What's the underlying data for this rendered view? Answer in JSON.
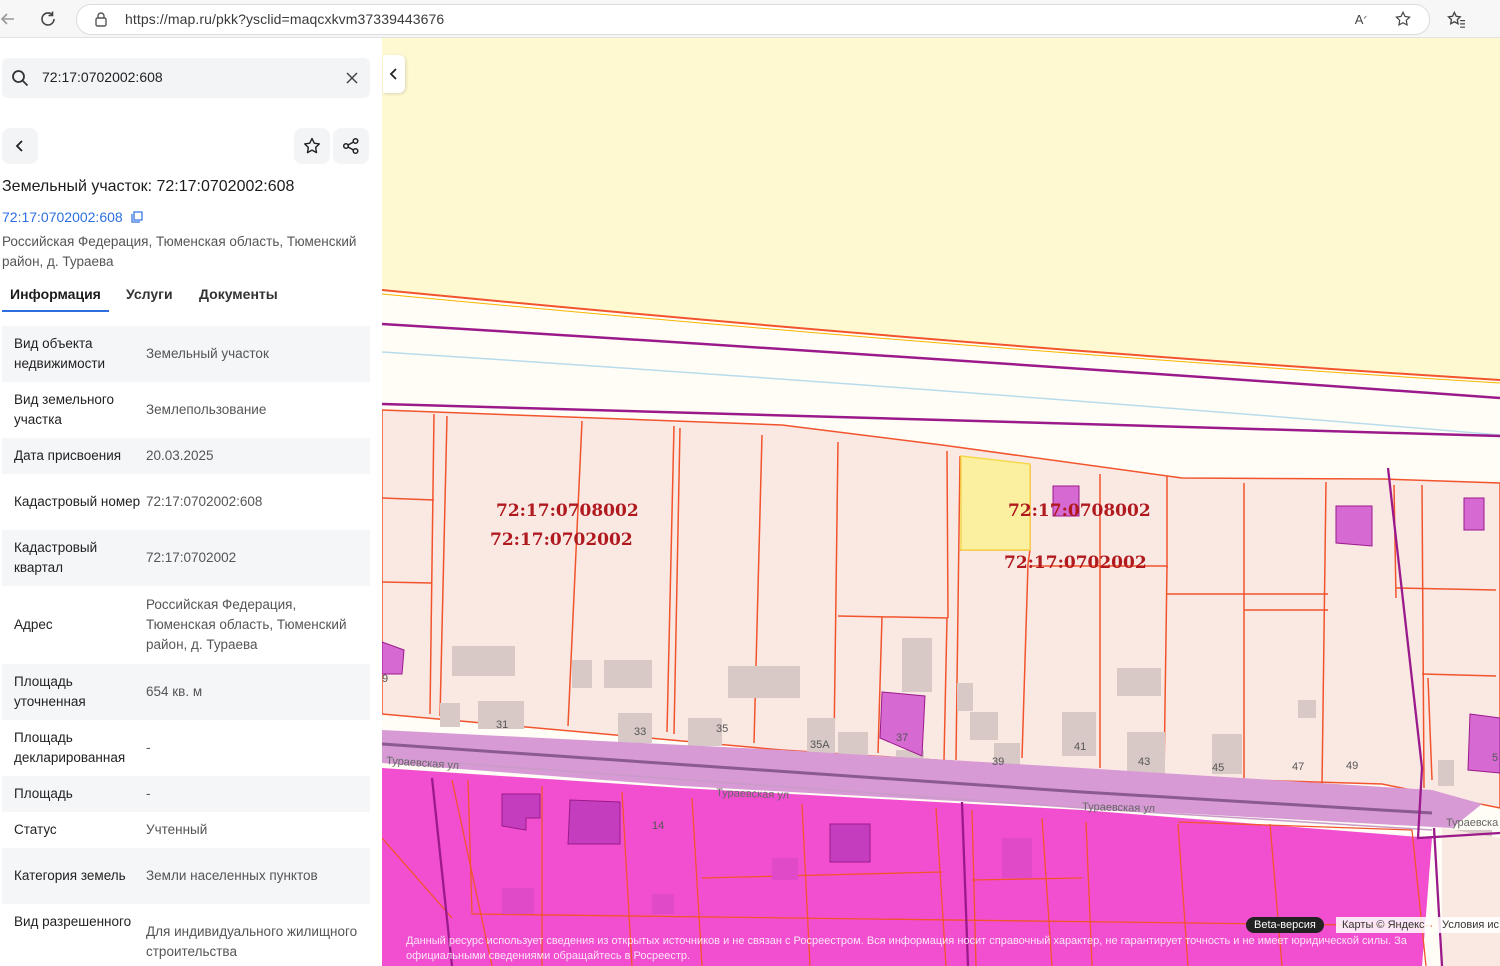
{
  "browser": {
    "url": "https://map.ru/pkk?ysclid=maqcxkvm37339443676",
    "icons": [
      "back-arrow-icon",
      "refresh-icon",
      "site-info-icon",
      "read-aloud-icon",
      "favorite-star-icon",
      "favorites-bar-icon"
    ]
  },
  "search": {
    "value": "72:17:0702002:608",
    "icons": [
      "search-icon",
      "clear-icon"
    ]
  },
  "card": {
    "title": "Земельный участок: 72:17:0702002:608",
    "cadastral_link": "72:17:0702002:608",
    "address": "Российская Федерация, Тюменская область, Тюменский район, д. Тураева"
  },
  "tabs": [
    {
      "label": "Информация",
      "active": true
    },
    {
      "label": "Услуги",
      "active": false
    },
    {
      "label": "Документы",
      "active": false
    }
  ],
  "properties": [
    {
      "key": "Вид объекта недвижимости",
      "value": "Земельный участок"
    },
    {
      "key": "Вид земельного участка",
      "value": "Землепользование"
    },
    {
      "key": "Дата присвоения",
      "value": "20.03.2025"
    },
    {
      "key": "Кадастровый номер",
      "value": "72:17:0702002:608"
    },
    {
      "key": "Кадастровый квартал",
      "value": "72:17:0702002"
    },
    {
      "key": "Адрес",
      "value": "Российская Федерация, Тюменская область, Тюменский район, д. Тураева"
    },
    {
      "key": "Площадь уточненная",
      "value": "654 кв. м"
    },
    {
      "key": "Площадь декларированная",
      "value": "-"
    },
    {
      "key": "Площадь",
      "value": "-"
    },
    {
      "key": "Статус",
      "value": "Учтенный"
    },
    {
      "key": "Категория земель",
      "value": "Земли населенных пунктов"
    },
    {
      "key": "Вид разрешенного",
      "value": "Для индивидуального жилищного строительства"
    }
  ],
  "map": {
    "quarter_labels": [
      "72:17:0708002",
      "72:17:0702002",
      "72:17:0708002",
      "72:17:0702002"
    ],
    "house_numbers": [
      "31",
      "33",
      "35",
      "35А",
      "37",
      "39",
      "41",
      "43",
      "45",
      "47",
      "49",
      "14",
      "9",
      "5"
    ],
    "streets": [
      "Тураевская ул",
      "Тураевская ул",
      "Тураевская ул",
      "Тураевска"
    ],
    "beta": "Beta-версия",
    "copyright": "Карты © Яндекс",
    "terms": "Условия ис",
    "disclaimer": "Данный ресурс использует сведения из открытых источников и не связан с Росреестром. Вся информация носит справочный характер, не гарантирует точность и не имеет юридической силы. За официальными сведениями обращайтесь в Росреестр.",
    "colors": {
      "parcel_fill": "#fae8e3",
      "parcel_border": "#f2542d",
      "selected_fill": "#faf0a0",
      "zone_magenta": "#f24fd0",
      "boundary_purple": "#9b1a8b",
      "label_red": "#b0191e"
    }
  }
}
